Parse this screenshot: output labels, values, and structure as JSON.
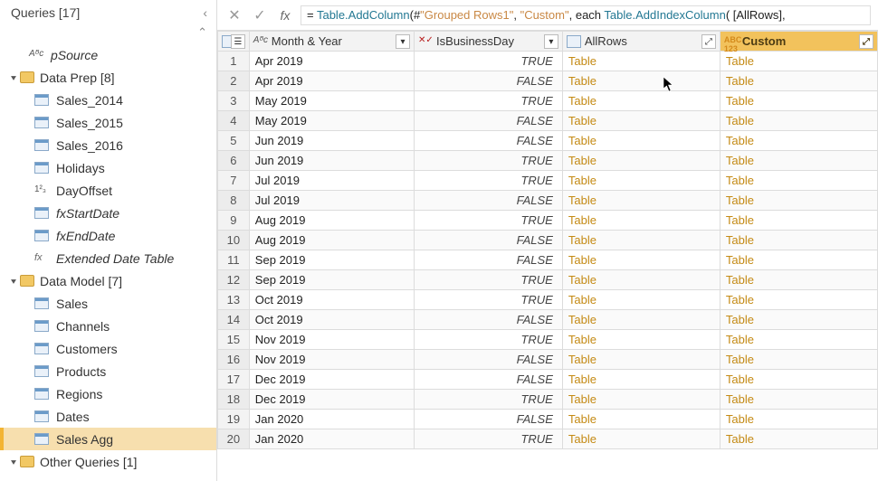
{
  "sidebar": {
    "header": "Queries [17]",
    "root_item": {
      "icon": "abc",
      "label": "pSource"
    },
    "groups": [
      {
        "label": "Data Prep [8]",
        "items": [
          {
            "icon": "tab",
            "label": "Sales_2014"
          },
          {
            "icon": "tab",
            "label": "Sales_2015"
          },
          {
            "icon": "tab",
            "label": "Sales_2016"
          },
          {
            "icon": "tab",
            "label": "Holidays"
          },
          {
            "icon": "123",
            "label": "DayOffset"
          },
          {
            "icon": "tab",
            "label": "fxStartDate",
            "fx": true
          },
          {
            "icon": "tab",
            "label": "fxEndDate",
            "fx": true
          },
          {
            "icon": "fx",
            "label": "Extended Date Table",
            "fx": true
          }
        ]
      },
      {
        "label": "Data Model [7]",
        "items": [
          {
            "icon": "tab",
            "label": "Sales"
          },
          {
            "icon": "tab",
            "label": "Channels"
          },
          {
            "icon": "tab",
            "label": "Customers"
          },
          {
            "icon": "tab",
            "label": "Products"
          },
          {
            "icon": "tab",
            "label": "Regions"
          },
          {
            "icon": "tab",
            "label": "Dates"
          },
          {
            "icon": "tab",
            "label": "Sales Agg",
            "selected": true
          }
        ]
      },
      {
        "label": "Other Queries [1]",
        "items": []
      }
    ]
  },
  "formula": {
    "raw": "= Table.AddColumn(#\"Grouped Rows1\", \"Custom\", each Table.AddIndexColumn( [AllRows],",
    "tokens": [
      {
        "t": "plain",
        "v": "= "
      },
      {
        "t": "fn",
        "v": "Table.AddColumn"
      },
      {
        "t": "plain",
        "v": "("
      },
      {
        "t": "plain",
        "v": "#"
      },
      {
        "t": "str",
        "v": "\"Grouped Rows1\""
      },
      {
        "t": "plain",
        "v": ", "
      },
      {
        "t": "str",
        "v": "\"Custom\""
      },
      {
        "t": "plain",
        "v": ", each "
      },
      {
        "t": "fn",
        "v": "Table.AddIndexColumn"
      },
      {
        "t": "plain",
        "v": "( [AllRows],"
      }
    ]
  },
  "grid": {
    "columns": [
      {
        "key": "rn",
        "label": "",
        "type": "rn"
      },
      {
        "key": "month",
        "label": "Month & Year",
        "type": "abc"
      },
      {
        "key": "bday",
        "label": "IsBusinessDay",
        "type": "bool"
      },
      {
        "key": "all",
        "label": "AllRows",
        "type": "tab"
      },
      {
        "key": "cust",
        "label": "Custom",
        "type": "abc123",
        "highlight": true
      }
    ],
    "rows": [
      {
        "rn": 1,
        "month": "Apr 2019",
        "bday": "TRUE",
        "all": "Table",
        "cust": "Table"
      },
      {
        "rn": 2,
        "month": "Apr 2019",
        "bday": "FALSE",
        "all": "Table",
        "cust": "Table"
      },
      {
        "rn": 3,
        "month": "May 2019",
        "bday": "TRUE",
        "all": "Table",
        "cust": "Table"
      },
      {
        "rn": 4,
        "month": "May 2019",
        "bday": "FALSE",
        "all": "Table",
        "cust": "Table"
      },
      {
        "rn": 5,
        "month": "Jun 2019",
        "bday": "FALSE",
        "all": "Table",
        "cust": "Table"
      },
      {
        "rn": 6,
        "month": "Jun 2019",
        "bday": "TRUE",
        "all": "Table",
        "cust": "Table"
      },
      {
        "rn": 7,
        "month": "Jul 2019",
        "bday": "TRUE",
        "all": "Table",
        "cust": "Table"
      },
      {
        "rn": 8,
        "month": "Jul 2019",
        "bday": "FALSE",
        "all": "Table",
        "cust": "Table"
      },
      {
        "rn": 9,
        "month": "Aug 2019",
        "bday": "TRUE",
        "all": "Table",
        "cust": "Table"
      },
      {
        "rn": 10,
        "month": "Aug 2019",
        "bday": "FALSE",
        "all": "Table",
        "cust": "Table"
      },
      {
        "rn": 11,
        "month": "Sep 2019",
        "bday": "FALSE",
        "all": "Table",
        "cust": "Table"
      },
      {
        "rn": 12,
        "month": "Sep 2019",
        "bday": "TRUE",
        "all": "Table",
        "cust": "Table"
      },
      {
        "rn": 13,
        "month": "Oct 2019",
        "bday": "TRUE",
        "all": "Table",
        "cust": "Table"
      },
      {
        "rn": 14,
        "month": "Oct 2019",
        "bday": "FALSE",
        "all": "Table",
        "cust": "Table"
      },
      {
        "rn": 15,
        "month": "Nov 2019",
        "bday": "TRUE",
        "all": "Table",
        "cust": "Table"
      },
      {
        "rn": 16,
        "month": "Nov 2019",
        "bday": "FALSE",
        "all": "Table",
        "cust": "Table"
      },
      {
        "rn": 17,
        "month": "Dec 2019",
        "bday": "FALSE",
        "all": "Table",
        "cust": "Table"
      },
      {
        "rn": 18,
        "month": "Dec 2019",
        "bday": "TRUE",
        "all": "Table",
        "cust": "Table"
      },
      {
        "rn": 19,
        "month": "Jan 2020",
        "bday": "FALSE",
        "all": "Table",
        "cust": "Table"
      },
      {
        "rn": 20,
        "month": "Jan 2020",
        "bday": "TRUE",
        "all": "Table",
        "cust": "Table"
      }
    ]
  },
  "icons": {
    "collapse": "‹",
    "scroll_up": "⌃",
    "tri": "▾",
    "filter": "▾",
    "expand": "⤢"
  }
}
